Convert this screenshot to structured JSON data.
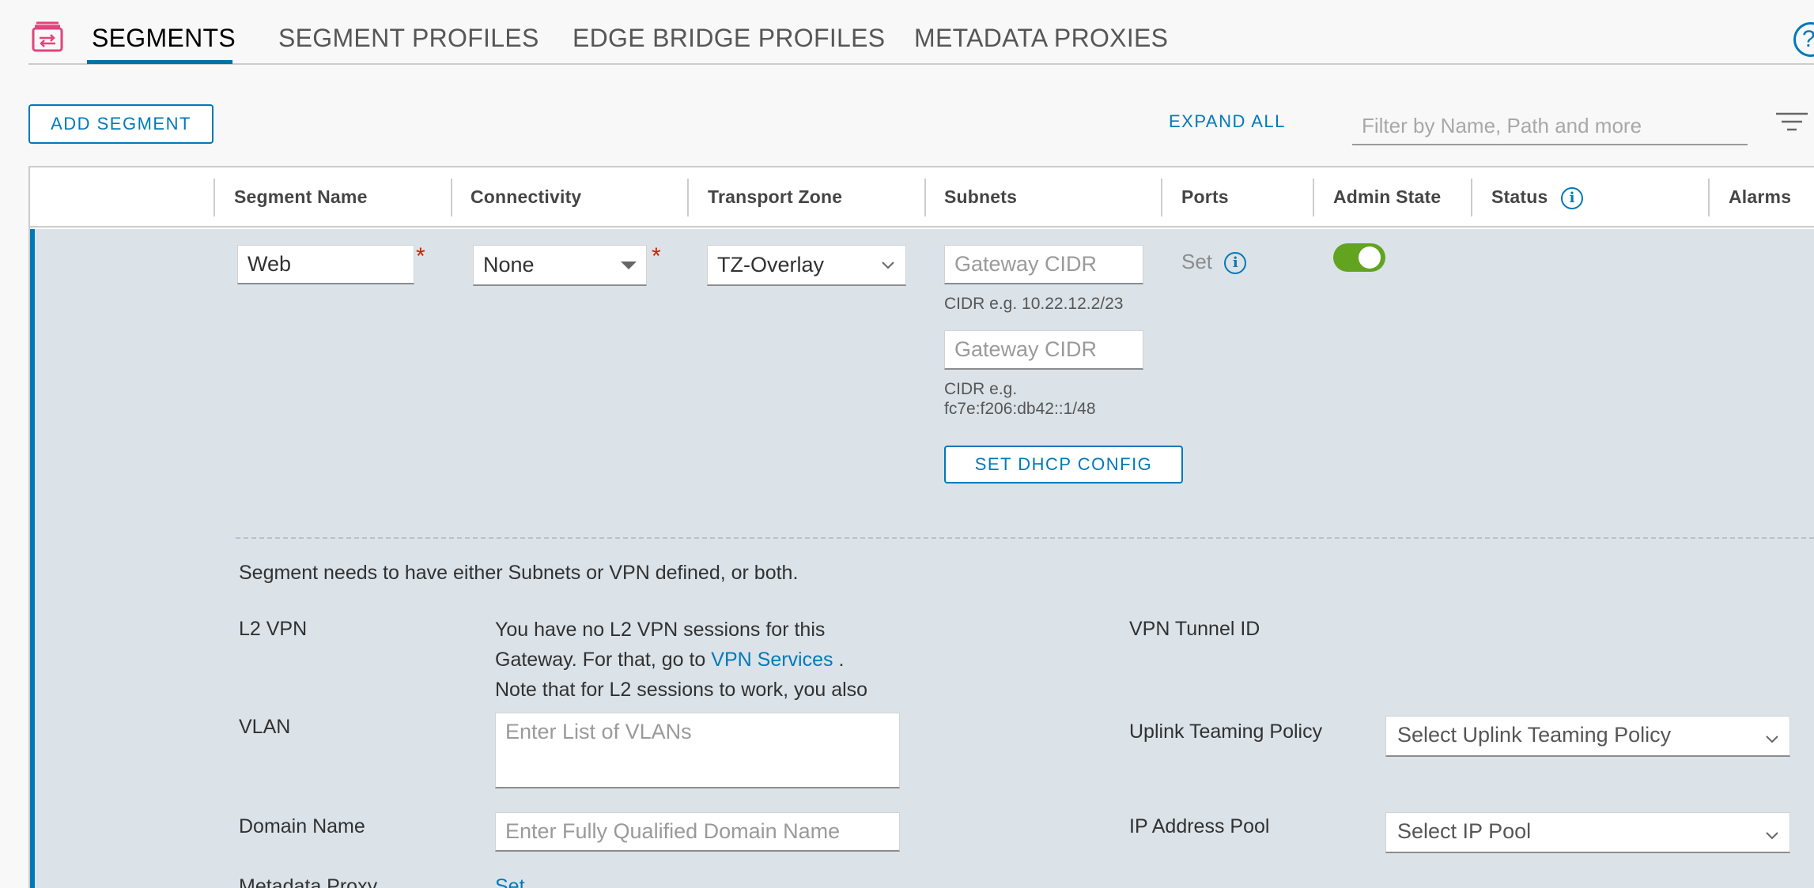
{
  "tabs": [
    {
      "label": "SEGMENTS"
    },
    {
      "label": "SEGMENT PROFILES"
    },
    {
      "label": "EDGE BRIDGE PROFILES"
    },
    {
      "label": "METADATA PROXIES"
    }
  ],
  "toolbar": {
    "add_segment": "ADD SEGMENT",
    "expand_all": "EXPAND ALL",
    "filter_placeholder": "Filter by Name, Path and more"
  },
  "columns": {
    "segment_name": "Segment Name",
    "connectivity": "Connectivity",
    "transport_zone": "Transport Zone",
    "subnets": "Subnets",
    "ports": "Ports",
    "admin_state": "Admin State",
    "status": "Status",
    "alarms": "Alarms"
  },
  "row": {
    "segment_name": "Web",
    "connectivity": "None",
    "transport_zone": "TZ-Overlay",
    "gateway_placeholder": "Gateway CIDR",
    "cidr_hint_v4": "CIDR e.g. 10.22.12.2/23",
    "cidr_hint_v6_line1": "CIDR e.g.",
    "cidr_hint_v6_line2": "fc7e:f206:db42::1/48",
    "dhcp_button": "SET DHCP CONFIG",
    "ports": "Set",
    "admin_state_enabled": true,
    "required_mark": "*"
  },
  "details": {
    "notice": "Segment needs to have either Subnets or VPN defined, or both.",
    "l2vpn_label": "L2 VPN",
    "l2vpn_text_1": "You have no L2 VPN sessions for this",
    "l2vpn_text_2": "Gateway. For that, go to",
    "l2vpn_link": "VPN Services",
    "l2vpn_text_3": ".",
    "l2vpn_text_4": "Note that for L2 sessions to work, you also",
    "vpn_tunnel_label": "VPN Tunnel ID",
    "vlan_label": "VLAN",
    "vlan_placeholder": "Enter List of VLANs",
    "uplink_label": "Uplink Teaming Policy",
    "uplink_placeholder": "Select Uplink Teaming Policy",
    "domain_label": "Domain Name",
    "domain_placeholder": "Enter Fully Qualified Domain Name",
    "ip_pool_label": "IP Address Pool",
    "ip_pool_placeholder": "Select IP Pool",
    "metadata_label": "Metadata Proxy",
    "metadata_link": "Set"
  }
}
